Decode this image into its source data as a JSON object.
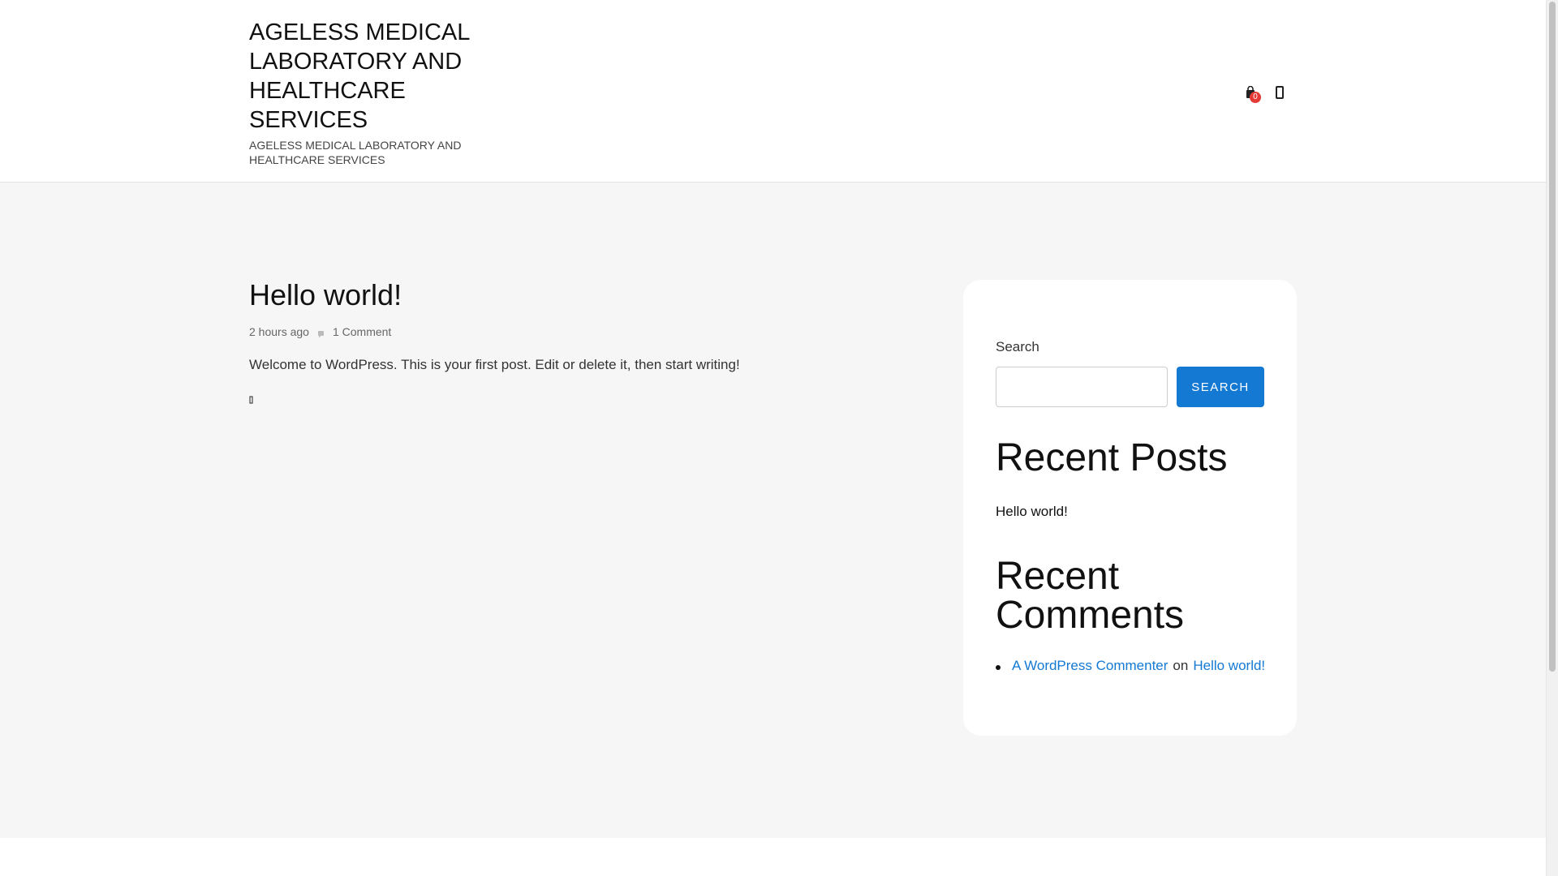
{
  "header": {
    "site_title": "AGELESS MEDICAL LABORATORY AND HEALTHCARE SERVICES",
    "site_description": "AGELESS MEDICAL LABORATORY AND HEALTHCARE SERVICES",
    "cart_count": "0",
    "cart_icon": "shopping-bag-icon",
    "user_icon": "user-icon"
  },
  "post": {
    "title": "Hello world!",
    "date": "2 hours ago",
    "comments": "1 Comment",
    "excerpt": "Welcome to WordPress. This is your first post. Edit or delete it, then start writing!",
    "read_more_icon": "arrow-right-icon"
  },
  "sidebar": {
    "search_label": "Search",
    "search_value": "",
    "search_button": "SEARCH",
    "recent_posts_heading": "Recent Posts",
    "recent_posts": [
      "Hello world!"
    ],
    "recent_comments_heading": "Recent Comments",
    "recent_comments": [
      {
        "author": "A WordPress Commenter",
        "on": "on",
        "post": "Hello world!"
      }
    ]
  },
  "colors": {
    "accent": "#1479d3",
    "badge": "#e53935",
    "page_bg": "#f6f6f6",
    "card_bg": "#ffffff"
  }
}
